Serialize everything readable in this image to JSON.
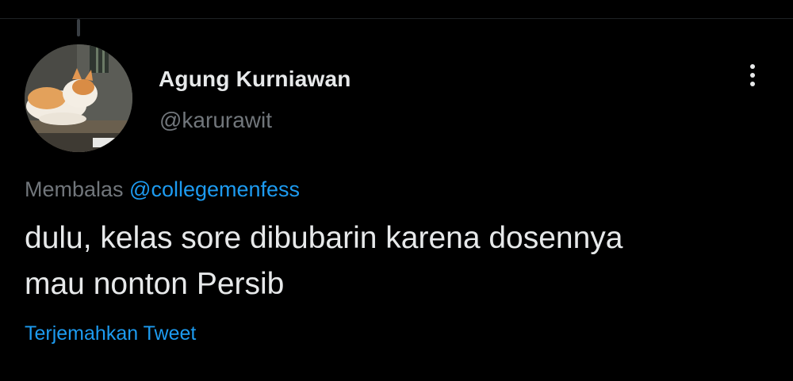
{
  "tweet": {
    "author": {
      "display_name": "Agung Kurniawan",
      "handle": "@karurawit",
      "avatar": "cat-photo-avatar"
    },
    "more_icon": "more-vertical-icon",
    "reply_to": {
      "prefix": "Membalas ",
      "mention": "@collegemenfess"
    },
    "text_line_1": "dulu, kelas sore dibubarin karena dosennya",
    "text_line_2": "mau nonton Persib",
    "translate_label": "Terjemahkan Tweet"
  },
  "colors": {
    "background": "#000000",
    "primary_text": "#e7e9ea",
    "secondary_text": "#71767b",
    "accent": "#1d9bf0"
  }
}
